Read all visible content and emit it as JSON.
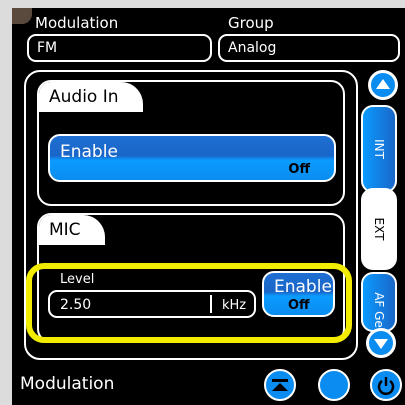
{
  "modulation_field": {
    "label": "Modulation",
    "value": "FM"
  },
  "group_field": {
    "label": "Group",
    "value": "Analog"
  },
  "audio_in": {
    "title": "Audio In",
    "enable_label": "Enable",
    "enable_state": "Off"
  },
  "mic": {
    "title": "MIC",
    "level_label": "Level",
    "level_value": "2.50",
    "level_unit": "kHz",
    "enable_label": "Enable",
    "enable_state": "Off"
  },
  "side_tabs": [
    "INT",
    "EXT",
    "AF Ge"
  ],
  "footer": {
    "title": "Modulation"
  },
  "colors": {
    "accent": "#0a8cf0",
    "highlight": "#f2ec00",
    "background": "#000000"
  }
}
